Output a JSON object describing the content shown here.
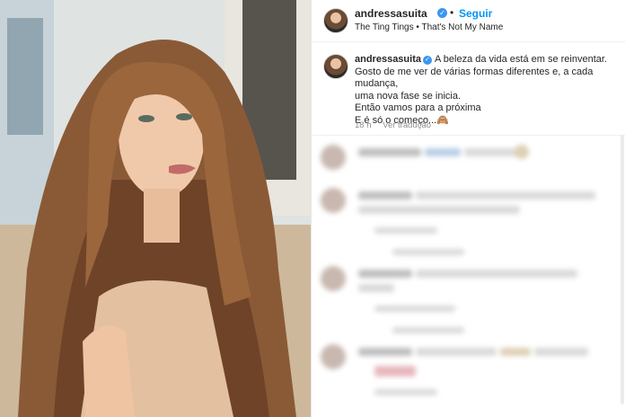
{
  "post": {
    "username": "andressasuita",
    "follow_label": "Seguir",
    "separator": "•",
    "music": "The Ting Tings • That's Not My Name",
    "verified_glyph": "✓"
  },
  "caption": {
    "username": "andressasuita",
    "lines": [
      "A beleza da vida está em se reinventar.",
      "Gosto de me ver de várias formas diferentes e, a cada mudança,",
      "uma nova fase se inicia.",
      "Então vamos para a próxima",
      "E é só o começo...🙈"
    ]
  },
  "meta": {
    "time": "18 h",
    "translate": "Ver tradução"
  },
  "colors": {
    "link_blue": "#0095f6",
    "verified_blue": "#3897f0",
    "text": "#262626",
    "secondary": "#8e8e8e"
  },
  "icons": [
    "verified-badge-icon"
  ]
}
